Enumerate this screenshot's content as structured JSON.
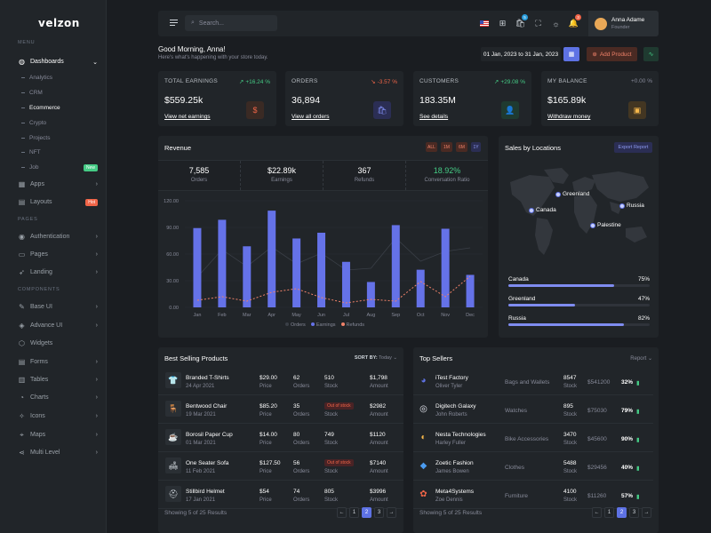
{
  "brand": "velzon",
  "sidebar": {
    "menu_title": "MENU",
    "pages_title": "PAGES",
    "components_title": "COMPONENTS",
    "dashboards_label": "Dashboards",
    "dashboard_subs": [
      "Analytics",
      "CRM",
      "Ecommerce",
      "Crypto",
      "Projects",
      "NFT",
      "Job"
    ],
    "job_badge": "New",
    "apps_label": "Apps",
    "layouts_label": "Layouts",
    "layouts_badge": "Hot",
    "pages_items": [
      "Authentication",
      "Pages",
      "Landing"
    ],
    "component_items": [
      "Base UI",
      "Advance UI",
      "Widgets",
      "Forms",
      "Tables",
      "Charts",
      "Icons",
      "Maps",
      "Multi Level"
    ]
  },
  "topbar": {
    "search_placeholder": "Search...",
    "cart_count": "5",
    "notif_count": "3",
    "user_name": "Anna Adame",
    "user_role": "Founder"
  },
  "greeting": {
    "title": "Good Morning, Anna!",
    "subtitle": "Here's what's happening with your store today.",
    "date_range": "01 Jan, 2023 to 31 Jan, 2023",
    "add_product": "Add Product"
  },
  "kpis": [
    {
      "label": "TOTAL EARNINGS",
      "change": "+16.24 %",
      "change_color": "#45cb85",
      "arrow": "↗",
      "value": "$559.25k",
      "link": "View net earnings",
      "icon_bg": "#3a2a24",
      "icon_color": "#f06548",
      "icon": "$"
    },
    {
      "label": "ORDERS",
      "change": "-3.57 %",
      "change_color": "#f06548",
      "arrow": "↘",
      "value": "36,894",
      "link": "View all orders",
      "icon_bg": "#2b2e54",
      "icon_color": "#7f8cf0",
      "icon": "🛍"
    },
    {
      "label": "CUSTOMERS",
      "change": "+29.08 %",
      "change_color": "#45cb85",
      "arrow": "↗",
      "value": "183.35M",
      "link": "See details",
      "icon_bg": "#1f3a30",
      "icon_color": "#45cb85",
      "icon": "👤"
    },
    {
      "label": "MY BALANCE",
      "change": "+0.00 %",
      "change_color": "#878a99",
      "arrow": "",
      "value": "$165.89k",
      "link": "Withdraw money",
      "icon_bg": "#433622",
      "icon_color": "#f7b84b",
      "icon": "▣"
    }
  ],
  "revenue": {
    "title": "Revenue",
    "ranges": [
      "ALL",
      "1M",
      "6M",
      "1Y"
    ],
    "stats": [
      {
        "value": "7,585",
        "label": "Orders",
        "color": "#ffffff"
      },
      {
        "value": "$22.89k",
        "label": "Earnings",
        "color": "#ffffff"
      },
      {
        "value": "367",
        "label": "Refunds",
        "color": "#ffffff"
      },
      {
        "value": "18.92%",
        "label": "Conversation Ratio",
        "color": "#45cb85"
      }
    ],
    "legend": [
      "Orders",
      "Earnings",
      "Refunds"
    ]
  },
  "chart_data": {
    "type": "bar",
    "categories": [
      "Jan",
      "Feb",
      "Mar",
      "Apr",
      "May",
      "Jun",
      "Jul",
      "Aug",
      "Sep",
      "Oct",
      "Nov",
      "Dec"
    ],
    "series": [
      {
        "name": "Earnings",
        "type": "bar",
        "color": "#6572e8",
        "values": [
          89.25,
          98.58,
          68.74,
          108.87,
          77.54,
          84.03,
          51.24,
          28.57,
          92.57,
          42.36,
          88.51,
          36.57
        ]
      },
      {
        "name": "Refunds",
        "type": "line",
        "color": "#f0826a",
        "values": [
          8.0,
          12.0,
          7.0,
          17.0,
          21.0,
          11.0,
          5.0,
          9.0,
          7.0,
          29.0,
          12.0,
          35.0
        ]
      },
      {
        "name": "Orders",
        "type": "line",
        "color": "#3a3f47",
        "values": [
          34,
          65,
          46,
          68,
          49,
          61,
          42,
          44,
          78,
          52,
          63,
          67
        ]
      }
    ],
    "yticks": [
      "120.00",
      "90.00",
      "60.00",
      "30.00",
      "0.00"
    ],
    "ylim": [
      0,
      120
    ]
  },
  "locations": {
    "title": "Sales by Locations",
    "export": "Export Report",
    "pins": [
      "Greenland",
      "Canada",
      "Russia",
      "Palestine"
    ],
    "rows": [
      {
        "name": "Canada",
        "pct": "75%",
        "value": 75
      },
      {
        "name": "Greenland",
        "pct": "47%",
        "value": 47
      },
      {
        "name": "Russia",
        "pct": "82%",
        "value": 82
      }
    ]
  },
  "best_selling": {
    "title": "Best Selling Products",
    "sort_label": "SORT BY:",
    "sort_value": "Today",
    "price_label": "Price",
    "orders_label": "Orders",
    "stock_label": "Stock",
    "amount_label": "Amount",
    "rows": [
      {
        "name": "Branded T-Shirts",
        "date": "24 Apr 2021",
        "price": "$29.00",
        "orders": "62",
        "stock": "510",
        "out": "",
        "amount": "$1,798",
        "icon": "👕",
        "icon_color": "#f06548"
      },
      {
        "name": "Bentwood Chair",
        "date": "19 Mar 2021",
        "price": "$85.20",
        "orders": "35",
        "stock": "",
        "out": "Out of stock",
        "amount": "$2982",
        "icon": "🪑",
        "icon_color": "#ced4da"
      },
      {
        "name": "Borosil Paper Cup",
        "date": "01 Mar 2021",
        "price": "$14.00",
        "orders": "80",
        "stock": "749",
        "out": "",
        "amount": "$1120",
        "icon": "☕",
        "icon_color": "#f7b84b"
      },
      {
        "name": "One Seater Sofa",
        "date": "11 Feb 2021",
        "price": "$127.50",
        "orders": "56",
        "stock": "",
        "out": "Out of stock",
        "amount": "$7140",
        "icon": "🛋",
        "icon_color": "#ced4da"
      },
      {
        "name": "Stillbird Helmet",
        "date": "17 Jan 2021",
        "price": "$54",
        "orders": "74",
        "stock": "805",
        "out": "",
        "amount": "$3996",
        "icon": "⛑",
        "icon_color": "#ced4da"
      }
    ],
    "showing": "Showing 5 of 25 Results",
    "pages": [
      "←",
      "1",
      "2",
      "3",
      "→"
    ]
  },
  "top_sellers": {
    "title": "Top Sellers",
    "report": "Report",
    "stock_label": "Stock",
    "rows": [
      {
        "name": "iTest Factory",
        "owner": "Oliver Tyler",
        "category": "Bags and Wallets",
        "stock": "8547",
        "amount": "$541200",
        "pct": "32%",
        "logo": "◕",
        "logo_color": "#5e72e4"
      },
      {
        "name": "Digitech Galaxy",
        "owner": "John Roberts",
        "category": "Watches",
        "stock": "895",
        "amount": "$75030",
        "pct": "79%",
        "logo": "◎",
        "logo_color": "#e4e6ee"
      },
      {
        "name": "Nesta Technologies",
        "owner": "Harley Fuller",
        "category": "Bike Accessories",
        "stock": "3470",
        "amount": "$45600",
        "pct": "90%",
        "logo": "◐",
        "logo_color": "#f7b84b"
      },
      {
        "name": "Zoetic Fashion",
        "owner": "James Bowen",
        "category": "Clothes",
        "stock": "5488",
        "amount": "$29456",
        "pct": "40%",
        "logo": "◆",
        "logo_color": "#4b9cf0"
      },
      {
        "name": "Meta4Systems",
        "owner": "Zoe Dennis",
        "category": "Furniture",
        "stock": "4100",
        "amount": "$11260",
        "pct": "57%",
        "logo": "✿",
        "logo_color": "#f06548"
      }
    ],
    "showing": "Showing 5 of 25 Results",
    "pages": [
      "←",
      "1",
      "2",
      "3",
      "→"
    ]
  }
}
